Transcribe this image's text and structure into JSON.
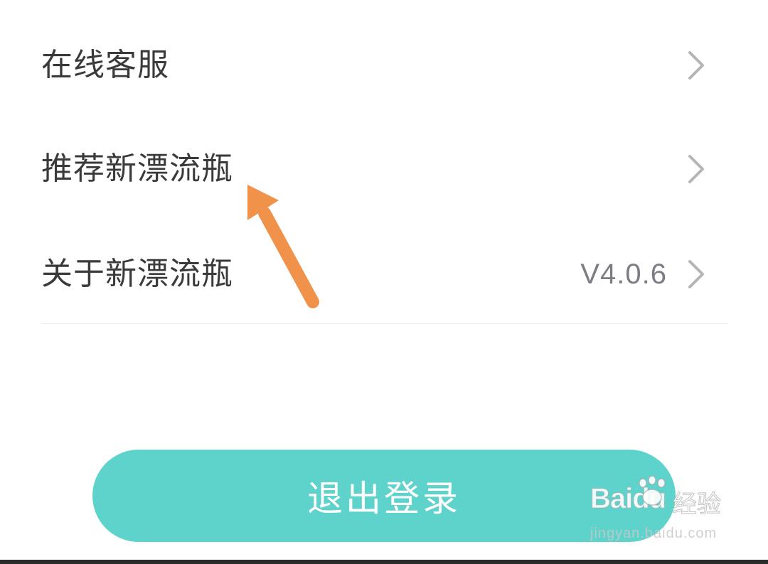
{
  "menu": {
    "items": [
      {
        "label": "在线客服",
        "value": ""
      },
      {
        "label": "推荐新漂流瓶",
        "value": ""
      },
      {
        "label": "关于新漂流瓶",
        "value": "V4.0.6"
      }
    ]
  },
  "logout": {
    "label": "退出登录"
  },
  "watermark": {
    "brand": "Baidu",
    "suffix": "经验",
    "url": "jingyan.baidu.com"
  },
  "colors": {
    "accent": "#5ed3cc",
    "annotation_arrow": "#f0924a",
    "text_primary": "#3a3a3a",
    "text_secondary": "#7c7c84",
    "chevron": "#b5b5b5"
  },
  "icons": {
    "chevron": "chevron-right-icon",
    "annotation": "arrow-annotation-icon"
  }
}
